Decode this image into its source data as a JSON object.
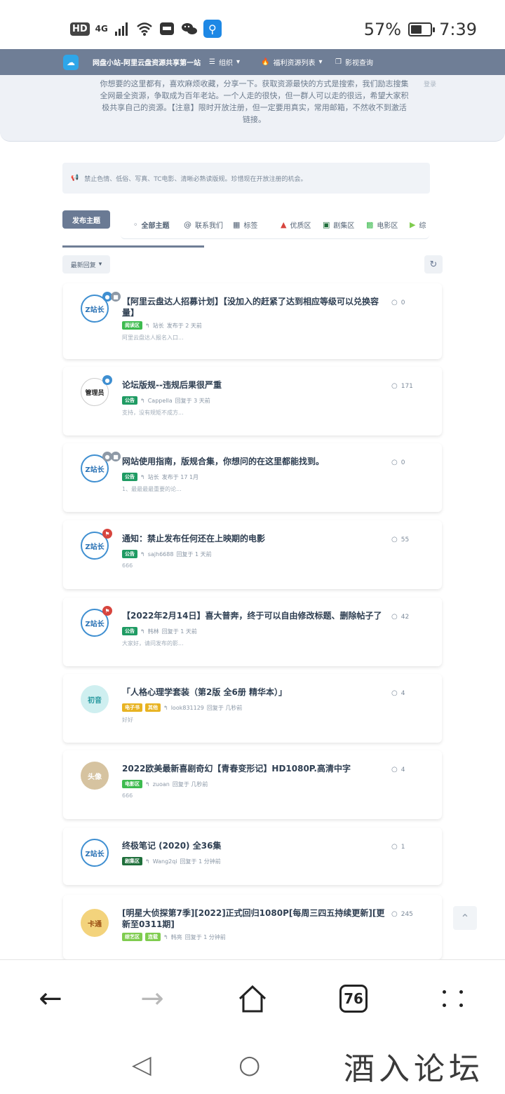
{
  "status_bar": {
    "hd": "HD",
    "network": "4G",
    "battery_percent": "57%",
    "battery_level": 0.57,
    "time": "7:39",
    "icons": [
      "hd-icon",
      "signal-icon",
      "wifi-icon",
      "app-icon",
      "wechat-icon",
      "search-app-icon"
    ]
  },
  "header": {
    "site_title": "网盘小站-阿里云盘资源共享第一站",
    "nav": [
      "组织",
      "福利资源列表",
      "影视查询"
    ]
  },
  "welcome": {
    "text": "你想要的这里都有，喜欢麻烦收藏，分享一下。获取资源最快的方式是搜索，我们励志搜集全网最全资源，争取成为百年老站。一个人走的很快，但一群人可以走的很远，希望大家积极共享自己的资源。【注意】限时开放注册，但一定要用真实，常用邮箱，不然收不到激活链接。",
    "login_hint": "登录"
  },
  "notice": "禁止色情、低俗、写真、TC电影、清晰必熟读版规。珍惜现在开放注册的机会。",
  "toolbar": {
    "start_discussion": "发布主题",
    "tags": [
      "全部主题",
      "联系我们",
      "标签",
      "优质区",
      "剧集区",
      "电影区",
      "综"
    ],
    "sort": "最新回复"
  },
  "discussions": [
    {
      "avatar": "Z站长",
      "title": "【阿里云盘达人招募计划】【没加入的赶紧了达到相应等级可以兑换容量】",
      "labels": [
        {
          "text": "阅读区",
          "color": "#3dbb4f"
        }
      ],
      "author": "站长",
      "action": "发布于 2 天前",
      "excerpt": "阿里云盘达人报名入口...",
      "replies": "0"
    },
    {
      "avatar": "管理员",
      "title": "论坛版规--违规后果很严重",
      "labels": [
        {
          "text": "公告",
          "color": "#1f9b63"
        }
      ],
      "author": "Cappella",
      "action": "回复于 3 天前",
      "excerpt": "支持，没有规矩不成方...",
      "replies": "171"
    },
    {
      "avatar": "Z站长",
      "title": "网站使用指南，版规合集，你想问的在这里都能找到。",
      "labels": [
        {
          "text": "公告",
          "color": "#1f9b63"
        }
      ],
      "author": "站长",
      "action": "发布于 17 1月",
      "excerpt": "1、最最最最重要的论...",
      "replies": "0"
    },
    {
      "avatar": "Z站长",
      "title": "通知：禁止发布任何还在上映期的电影",
      "labels": [
        {
          "text": "公告",
          "color": "#1f9b63"
        }
      ],
      "author": "sajh6688",
      "action": "回复于 1 天前",
      "excerpt": "666",
      "replies": "55"
    },
    {
      "avatar": "Z站长",
      "title": "【2022年2月14日】喜大普奔，终于可以自由修改标题、删除帖子了",
      "labels": [
        {
          "text": "公告",
          "color": "#1f9b63"
        }
      ],
      "author": "韩林",
      "action": "回复于 1 天前",
      "excerpt": "大家好，请问发布的影...",
      "replies": "42"
    },
    {
      "avatar": "初音",
      "title": "「人格心理学套装（第2版 全6册 精华本）」",
      "labels": [
        {
          "text": "电子书",
          "color": "#e8b322"
        },
        {
          "text": "其他",
          "color": "#e8b322"
        }
      ],
      "author": "look831129",
      "action": "回复于 几秒前",
      "excerpt": "好好",
      "replies": "4"
    },
    {
      "avatar": "头像",
      "title": "2022欧美最新喜剧奇幻【青春变形记】HD1080P.高清中字",
      "labels": [
        {
          "text": "电影区",
          "color": "#3dbb4f"
        }
      ],
      "author": "zuoan",
      "action": "回复于 几秒前",
      "excerpt": "666",
      "replies": "4"
    },
    {
      "avatar": "Z站长",
      "title": "终极笔记 (2020) 全36集",
      "labels": [
        {
          "text": "剧集区",
          "color": "#1f6f3b"
        }
      ],
      "author": "Wang2qi",
      "action": "回复于 1 分钟前",
      "excerpt": "",
      "replies": "1"
    },
    {
      "avatar": "卡通",
      "title": "[明星大侦探第7季][2022]正式回归1080P[每周三四五持续更新][更新至0311期]",
      "labels": [
        {
          "text": "综艺区",
          "color": "#7fcc4f"
        },
        {
          "text": "连载",
          "color": "#7fcc4f"
        }
      ],
      "author": "韩亮",
      "action": "回复于 1 分钟前",
      "excerpt": "",
      "replies": "245"
    }
  ],
  "browser": {
    "tab_count": "76"
  },
  "watermark": "酒入论坛"
}
